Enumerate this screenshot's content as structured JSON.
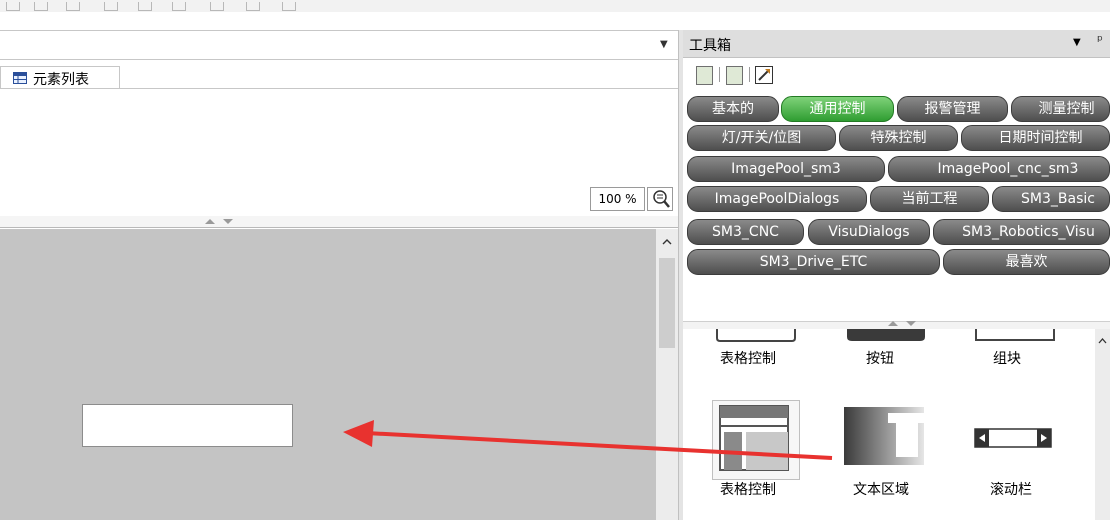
{
  "editor": {
    "element_list_tab": "元素列表",
    "zoom": "100 %"
  },
  "toolbox": {
    "title": "工具箱",
    "pin_glyph": "ᵖ",
    "categories": [
      {
        "label": "基本的",
        "active": false
      },
      {
        "label": "通用控制",
        "active": true
      },
      {
        "label": "报警管理",
        "active": false
      },
      {
        "label": "测量控制",
        "active": false
      },
      {
        "label": "灯/开关/位图",
        "active": false
      },
      {
        "label": "特殊控制",
        "active": false
      },
      {
        "label": "日期时间控制",
        "active": false
      },
      {
        "label": "ImagePool_sm3",
        "active": false
      },
      {
        "label": "ImagePool_cnc_sm3",
        "active": false
      },
      {
        "label": "ImagePoolDialogs",
        "active": false
      },
      {
        "label": "当前工程",
        "active": false
      },
      {
        "label": "SM3_Basic",
        "active": false
      },
      {
        "label": "SM3_CNC",
        "active": false
      },
      {
        "label": "VisuDialogs",
        "active": false
      },
      {
        "label": "SM3_Robotics_Visu",
        "active": false
      },
      {
        "label": "SM3_Drive_ETC",
        "active": false
      },
      {
        "label": "最喜欢",
        "active": false
      }
    ],
    "items_row1": [
      "表格控制",
      "按钮",
      "组块"
    ],
    "items_row2": [
      "表格控制",
      "文本区域",
      "滚动栏"
    ]
  },
  "colors": {
    "active_tab": "#3aa63b",
    "tab": "#5a5a5a",
    "canvas": "#c4c4c4",
    "annotation_arrow": "#e8322f"
  }
}
